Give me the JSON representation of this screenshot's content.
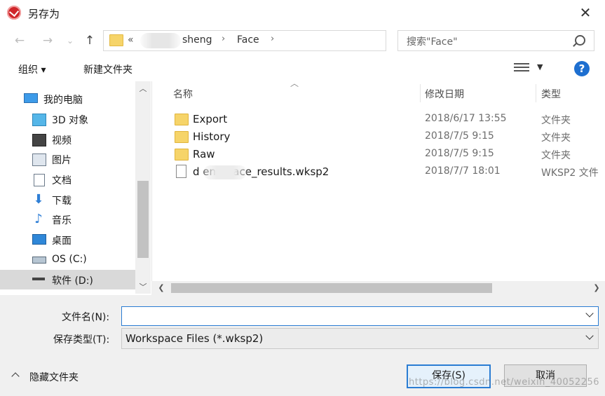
{
  "window": {
    "title": "另存为",
    "close": "✕"
  },
  "nav": {
    "back": "←",
    "forward": "→",
    "recent": "⌄",
    "up": "↑",
    "address": {
      "prefix": "«",
      "crumb1": "sheng",
      "crumb2": "Face",
      "sep": "›"
    },
    "search_placeholder": "搜索\"Face\""
  },
  "toolbar": {
    "organize": "组织 ▾",
    "new_folder": "新建文件夹"
  },
  "sidebar": {
    "items": [
      {
        "label": "我的电脑",
        "icon": "computer-icon"
      },
      {
        "label": "3D 对象",
        "icon": "3d-objects-icon"
      },
      {
        "label": "视频",
        "icon": "video-icon"
      },
      {
        "label": "图片",
        "icon": "pictures-icon"
      },
      {
        "label": "文档",
        "icon": "documents-icon"
      },
      {
        "label": "下载",
        "icon": "download-icon"
      },
      {
        "label": "音乐",
        "icon": "music-icon"
      },
      {
        "label": "桌面",
        "icon": "desktop-icon"
      },
      {
        "label": "OS (C:)",
        "icon": "drive-icon"
      },
      {
        "label": "软件 (D:)",
        "icon": "drive-icon",
        "selected": true
      }
    ]
  },
  "columns": {
    "name": "名称",
    "date": "修改日期",
    "type": "类型"
  },
  "files": [
    {
      "name": "Export",
      "date": "2018/6/17 13:55",
      "type": "文件夹",
      "kind": "folder"
    },
    {
      "name": "History",
      "date": "2018/7/5 9:15",
      "type": "文件夹",
      "kind": "folder"
    },
    {
      "name": "Raw",
      "date": "2018/7/5 9:15",
      "type": "文件夹",
      "kind": "folder"
    },
    {
      "name": "d        eng_Face_results.wksp2",
      "date": "2018/7/7 18:01",
      "type": "WKSP2 文件",
      "kind": "file"
    }
  ],
  "form": {
    "filename_label": "文件名(N):",
    "filename_value": "",
    "filetype_label": "保存类型(T):",
    "filetype_value": "Workspace Files (*.wksp2)"
  },
  "footer": {
    "hide_folders": "隐藏文件夹",
    "save": "保存(S)",
    "cancel": "取消",
    "watermark": "https://blog.csdn.net/weixin_40052256"
  }
}
